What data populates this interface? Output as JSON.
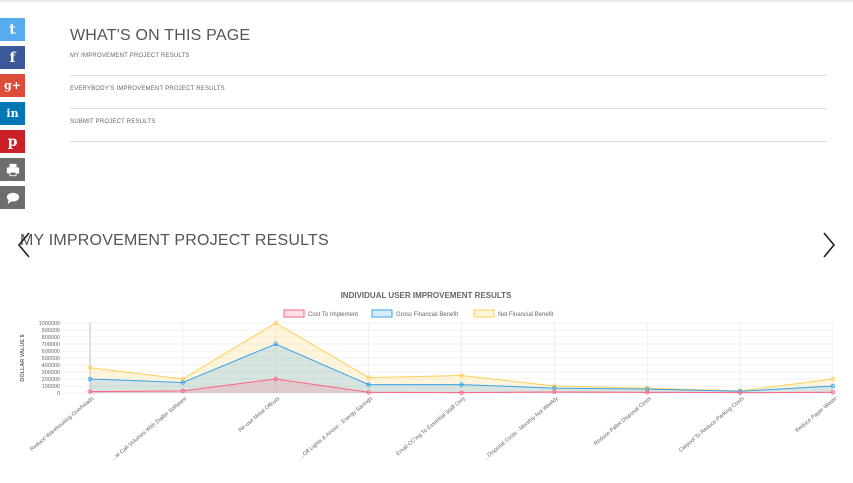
{
  "social": [
    {
      "name": "twitter",
      "color": "#55acee",
      "glyph": "t"
    },
    {
      "name": "facebook",
      "color": "#3b5998",
      "glyph": "f"
    },
    {
      "name": "google-plus",
      "color": "#dd4b39",
      "glyph": "g+"
    },
    {
      "name": "linkedin",
      "color": "#0077b5",
      "glyph": "in"
    },
    {
      "name": "pinterest",
      "color": "#cb2027",
      "glyph": "p"
    },
    {
      "name": "print",
      "color": "#6d6d6d",
      "glyph": "print"
    },
    {
      "name": "comment",
      "color": "#6d6d6d",
      "glyph": "comment"
    }
  ],
  "toc": {
    "title": "WHAT'S ON THIS PAGE",
    "items": [
      "MY IMPROVEMENT PROJECT RESULTS",
      "EVERYBODY'S IMPROVEMENT PROJECT RESULTS",
      "SUBMIT PROJECT RESULTS"
    ]
  },
  "section": {
    "title": "MY IMPROVEMENT PROJECT RESULTS"
  },
  "chart_data": {
    "type": "area",
    "title": "INDIVIDUAL USER IMPROVEMENT RESULTS",
    "ylabel": "DOLLAR VALUE $",
    "ylim": [
      0,
      1000000
    ],
    "yticks": [
      0,
      100000,
      200000,
      300000,
      400000,
      500000,
      600000,
      700000,
      800000,
      900000,
      1000000
    ],
    "grid": true,
    "legend_placement": "top-center",
    "categories": [
      "Reduce Warehousing Overheads",
      "...te Call-Volumes With Dialler Software",
      "Re-use Metal Offcuts",
      "...Off Lights & Aircon - Energy Savings",
      "Email CC'ing To Essential Staff Only",
      "...Disposal Costs - Monthly Not Weekly",
      "Reduce Pallet Disposal Costs",
      "Carpool To Reduce Parking Costs",
      "Reduce Paper Waste"
    ],
    "series": [
      {
        "name": "Cost To Implement",
        "color": "#ff6384",
        "fill": "rgba(255,99,132,0.2)",
        "values": [
          20000,
          30000,
          200000,
          10000,
          5000,
          15000,
          10000,
          5000,
          10000
        ]
      },
      {
        "name": "Gross Financial Benefit",
        "color": "#36a2eb",
        "fill": "rgba(54,162,235,0.2)",
        "values": [
          200000,
          150000,
          700000,
          120000,
          120000,
          70000,
          55000,
          25000,
          100000
        ]
      },
      {
        "name": "Net Financial Benefit",
        "color": "#ffce56",
        "fill": "rgba(255,206,86,0.2)",
        "values": [
          360000,
          200000,
          1000000,
          220000,
          250000,
          100000,
          70000,
          30000,
          200000
        ]
      }
    ]
  }
}
